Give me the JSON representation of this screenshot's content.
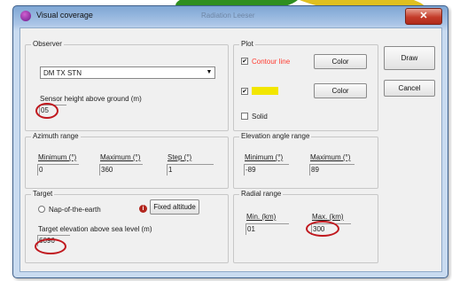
{
  "window": {
    "title": "Visual coverage",
    "background_title": "Radiation Leeser"
  },
  "observer": {
    "legend": "Observer",
    "station": "DM TX STN",
    "sensor_label": "Sensor height above ground (m)",
    "sensor_value": "05"
  },
  "plot": {
    "legend": "Plot",
    "contour_label": "Contour line",
    "contour_checked": "✔",
    "filled_checked": "✔",
    "solid_label": "Solid",
    "color_label": "Color",
    "contour_color": "#ff3b30",
    "filled_color": "#f2e600"
  },
  "buttons": {
    "draw": "Draw",
    "cancel": "Cancel"
  },
  "azimuth": {
    "legend": "Azimuth range",
    "min_label": "Minimum (°)",
    "min_value": "0",
    "max_label": "Maximum (°)",
    "max_value": "360",
    "step_label": "Step (°)",
    "step_value": "1"
  },
  "elevation": {
    "legend": "Elevation angle range",
    "min_label": "Minimum (°)",
    "min_value": "-89",
    "max_label": "Maximum (°)",
    "max_value": "89"
  },
  "target": {
    "legend": "Target",
    "nap_label": "Nap-of-the-earth",
    "fixed_label": "Fixed altitude",
    "elev_label": "Target elevation above sea level (m)",
    "elev_value": "6096"
  },
  "radial": {
    "legend": "Radial range",
    "min_label": "Min. (km)",
    "min_value": "01",
    "max_label": "Max. (km)",
    "max_value": "300"
  },
  "annotation_color": "#c0181e"
}
